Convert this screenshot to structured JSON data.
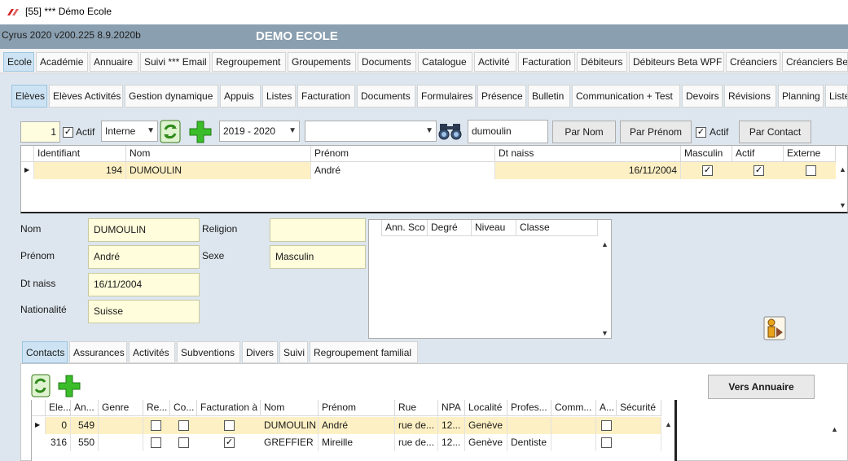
{
  "window": {
    "title": "[55] *** Démo Ecole"
  },
  "header": {
    "version": "Cyrus 2020 v200.225 8.9.2020b",
    "school": "DEMO ECOLE"
  },
  "menu": [
    "Ecole",
    "Académie",
    "Annuaire",
    "Suivi *** Email",
    "Regroupement",
    "Groupements",
    "Documents",
    "Catalogue",
    "Activité",
    "Facturation",
    "Débiteurs",
    "Débiteurs Beta WPF",
    "Créanciers",
    "Créanciers Beta"
  ],
  "subtabs": [
    "Elèves",
    "Elèves Activités",
    "Gestion dynamique",
    "Appuis",
    "Listes",
    "Facturation",
    "Documents",
    "Formulaires",
    "Présence",
    "Bulletin",
    "Communication + Test",
    "Devoirs",
    "Révisions",
    "Planning",
    "Liste"
  ],
  "filters": {
    "count": "1",
    "actif_label": "Actif",
    "type": "Interne",
    "year": "2019 - 2020",
    "extra": "",
    "search": "dumoulin",
    "by_name": "Par Nom",
    "by_firstname": "Par Prénom",
    "actif2_label": "Actif",
    "by_contact": "Par Contact"
  },
  "students_grid": {
    "headers": [
      "Identifiant",
      "Nom",
      "Prénom",
      "Dt naiss",
      "Masculin",
      "Actif",
      "Externe"
    ],
    "rows": [
      {
        "id": "194",
        "nom": "DUMOULIN",
        "prenom": "André",
        "dtnaiss": "16/11/2004",
        "masculin": true,
        "actif": true,
        "externe": false
      }
    ]
  },
  "details": {
    "nom_label": "Nom",
    "nom": "DUMOULIN",
    "prenom_label": "Prénom",
    "prenom": "André",
    "dtnaiss_label": "Dt naiss",
    "dtnaiss": "16/11/2004",
    "nationalite_label": "Nationalité",
    "nationalite": "Suisse",
    "religion_label": "Religion",
    "religion": "",
    "sexe_label": "Sexe",
    "sexe": "Masculin"
  },
  "classes_grid": {
    "headers": [
      "Ann. Sco",
      "Degré",
      "Niveau",
      "Classe"
    ]
  },
  "lower_tabs": [
    "Contacts",
    "Assurances",
    "Activités",
    "Subventions",
    "Divers",
    "Suivi",
    "Regroupement familial"
  ],
  "contacts": {
    "vers_annuaire": "Vers Annuaire",
    "headers": [
      "Ele...",
      "An...",
      "Genre",
      "Re...",
      "Co...",
      "Facturation à",
      "Nom",
      "Prénom",
      "Rue",
      "NPA",
      "Localité",
      "Profes...",
      "Comm...",
      "A...",
      "Sécurité"
    ],
    "rows": [
      {
        "ele": "0",
        "an": "549",
        "genre": "",
        "re": false,
        "co": false,
        "fact": false,
        "nom": "DUMOULIN",
        "prenom": "André",
        "rue": "rue de...",
        "npa": "12...",
        "localite": "Genève",
        "prof": "",
        "comm": "",
        "a": false,
        "secu": ""
      },
      {
        "ele": "316",
        "an": "550",
        "genre": "",
        "re": false,
        "co": false,
        "fact": true,
        "nom": "GREFFIER",
        "prenom": "Mireille",
        "rue": "rue de...",
        "npa": "12...",
        "localite": "Genève",
        "prof": "Dentiste",
        "comm": "",
        "a": false,
        "secu": ""
      }
    ]
  },
  "colors": {
    "accent": "#cde3f3",
    "header": "#8a9fb0",
    "selected_row": "#fdf0c4",
    "field_bg": "#fffddb"
  }
}
